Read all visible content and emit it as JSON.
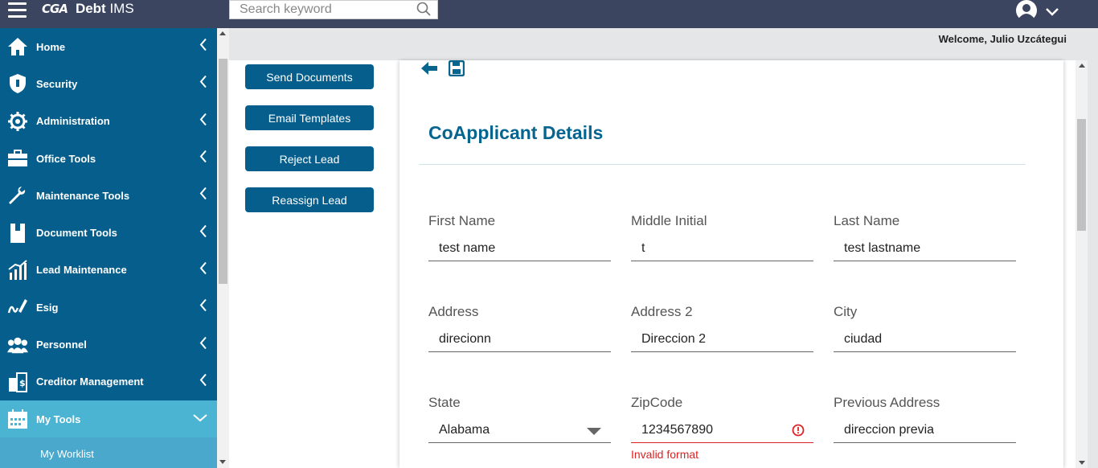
{
  "header": {
    "logo_text": "CGA",
    "app_name_bold": "Debt",
    "app_name_rest": " IMS",
    "search_placeholder": "Search keyword"
  },
  "welcome": "Welcome, Julio Uzcátegui",
  "sidebar": {
    "items": [
      {
        "label": "Home",
        "icon": "home-icon"
      },
      {
        "label": "Security",
        "icon": "shield-icon"
      },
      {
        "label": "Administration",
        "icon": "gear-icon"
      },
      {
        "label": "Office Tools",
        "icon": "briefcase-icon"
      },
      {
        "label": "Maintenance Tools",
        "icon": "wrench-icon"
      },
      {
        "label": "Document Tools",
        "icon": "book-icon"
      },
      {
        "label": "Lead Maintenance",
        "icon": "chart-icon"
      },
      {
        "label": "Esig",
        "icon": "signature-icon"
      },
      {
        "label": "Personnel",
        "icon": "people-icon"
      },
      {
        "label": "Creditor Management",
        "icon": "creditor-icon"
      },
      {
        "label": "My Tools",
        "icon": "calendar-icon"
      }
    ],
    "sub_items": [
      {
        "label": "My Worklist"
      }
    ]
  },
  "actions": [
    {
      "label": "Send Documents"
    },
    {
      "label": "Email Templates"
    },
    {
      "label": "Reject Lead"
    },
    {
      "label": "Reassign Lead"
    }
  ],
  "card": {
    "title": "CoApplicant Details"
  },
  "form": {
    "first_name": {
      "label": "First Name",
      "value": "test name"
    },
    "middle_initial": {
      "label": "Middle Initial",
      "value": "t"
    },
    "last_name": {
      "label": "Last Name",
      "value": "test lastname"
    },
    "address": {
      "label": "Address",
      "value": "direcionn"
    },
    "address2": {
      "label": "Address 2",
      "value": "Direccion 2"
    },
    "city": {
      "label": "City",
      "value": "ciudad"
    },
    "state": {
      "label": "State",
      "value": "Alabama"
    },
    "zipcode": {
      "label": "ZipCode",
      "value": "1234567890",
      "error": "Invalid format"
    },
    "previous_address": {
      "label": "Previous Address",
      "value": "direccion previa"
    }
  },
  "colors": {
    "topbar": "#3b4560",
    "sidebar": "#055e8c",
    "sidebar_active": "#4bb4d3",
    "accent": "#05658f",
    "error": "#dd2222"
  }
}
